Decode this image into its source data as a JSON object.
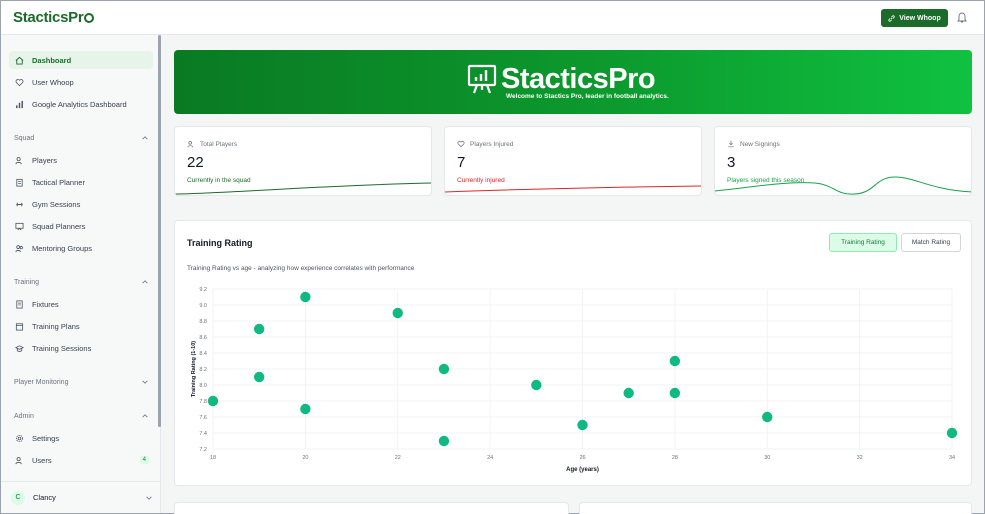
{
  "header": {
    "logo": "StacticsPr",
    "view_button": "View Whoop"
  },
  "sidebar": {
    "top_items": [
      {
        "label": "Dashboard",
        "icon": "home-icon",
        "active": true
      },
      {
        "label": "User Whoop",
        "icon": "heart-icon"
      },
      {
        "label": "Google Analytics Dashboard",
        "icon": "bar-chart-icon"
      }
    ],
    "sections": [
      {
        "title": "Squad",
        "items": [
          "Players",
          "Tactical Planner",
          "Gym Sessions",
          "Squad Planners",
          "Mentoring Groups"
        ]
      },
      {
        "title": "Training",
        "items": [
          "Fixtures",
          "Training Plans",
          "Training Sessions"
        ]
      },
      {
        "title": "Player Monitoring",
        "items": []
      },
      {
        "title": "Admin",
        "items": [
          "Settings",
          "Users"
        ]
      }
    ],
    "users_badge": "4",
    "user": {
      "initial": "C",
      "name": "Clancy"
    }
  },
  "banner": {
    "title": "StacticsPro",
    "subtitle": "Welcome to Stactics Pro, leader in football analytics."
  },
  "stats": [
    {
      "label": "Total Players",
      "value": "22",
      "note": "Currently in the squad",
      "color": "#1b6b2a"
    },
    {
      "label": "Players Injured",
      "value": "7",
      "note": "Currently injured",
      "color": "#dc2626"
    },
    {
      "label": "New Signings",
      "value": "3",
      "note": "Players signed this season",
      "color": "#16a34a"
    }
  ],
  "rating_card": {
    "title": "Training Rating",
    "subtitle": "Training Rating vs age - analyzing how experience correlates with performance",
    "toggle_active": "Training Rating",
    "toggle_inactive": "Match Rating"
  },
  "chart_data": {
    "type": "scatter",
    "xlabel": "Age (years)",
    "ylabel": "Training Rating (1-10)",
    "xlim": [
      18,
      34
    ],
    "ylim": [
      7.2,
      9.2
    ],
    "xticks": [
      18,
      20,
      22,
      24,
      26,
      28,
      30,
      32,
      34
    ],
    "yticks": [
      7.2,
      7.4,
      7.6,
      7.8,
      8.0,
      8.2,
      8.4,
      8.6,
      8.8,
      9.0,
      9.2
    ],
    "color": "#10b981",
    "grid": true,
    "points": [
      {
        "x": 18,
        "y": 7.8
      },
      {
        "x": 19,
        "y": 8.7
      },
      {
        "x": 19,
        "y": 8.1
      },
      {
        "x": 20,
        "y": 9.1
      },
      {
        "x": 20,
        "y": 7.7
      },
      {
        "x": 22,
        "y": 8.9
      },
      {
        "x": 23,
        "y": 8.2
      },
      {
        "x": 23,
        "y": 7.3
      },
      {
        "x": 25,
        "y": 8.0
      },
      {
        "x": 26,
        "y": 7.5
      },
      {
        "x": 27,
        "y": 7.9
      },
      {
        "x": 28,
        "y": 8.3
      },
      {
        "x": 28,
        "y": 7.9
      },
      {
        "x": 30,
        "y": 7.6
      },
      {
        "x": 34,
        "y": 7.4
      }
    ]
  }
}
